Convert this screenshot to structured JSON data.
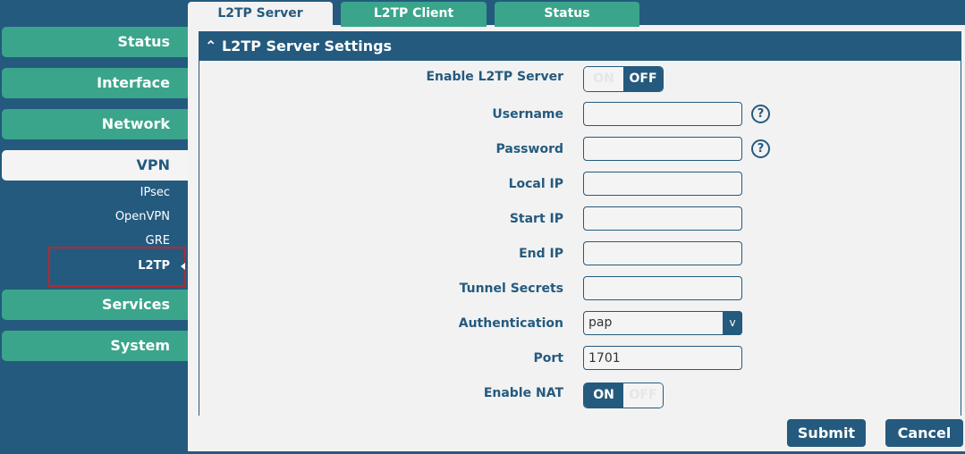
{
  "sidebar": {
    "status": "Status",
    "interface": "Interface",
    "network": "Network",
    "vpn": "VPN",
    "vpn_sub": [
      "IPsec",
      "OpenVPN",
      "GRE",
      "L2TP"
    ],
    "services": "Services",
    "system": "System"
  },
  "tabs": [
    "L2TP Server",
    "L2TP Client",
    "Status"
  ],
  "section": {
    "title": "L2TP Server Settings"
  },
  "form": {
    "enable_server": {
      "label": "Enable L2TP Server",
      "on": "ON",
      "off": "OFF",
      "value": "OFF"
    },
    "username": {
      "label": "Username",
      "value": ""
    },
    "password": {
      "label": "Password",
      "value": ""
    },
    "local_ip": {
      "label": "Local IP",
      "value": ""
    },
    "start_ip": {
      "label": "Start IP",
      "value": ""
    },
    "end_ip": {
      "label": "End IP",
      "value": ""
    },
    "tunnel_secrets": {
      "label": "Tunnel Secrets",
      "value": ""
    },
    "authentication": {
      "label": "Authentication",
      "value": "pap",
      "chevron": "v"
    },
    "port": {
      "label": "Port",
      "value": "1701"
    },
    "enable_nat": {
      "label": "Enable NAT",
      "on": "ON",
      "off": "OFF",
      "value": "ON"
    },
    "help": "?"
  },
  "buttons": {
    "submit": "Submit",
    "cancel": "Cancel"
  }
}
